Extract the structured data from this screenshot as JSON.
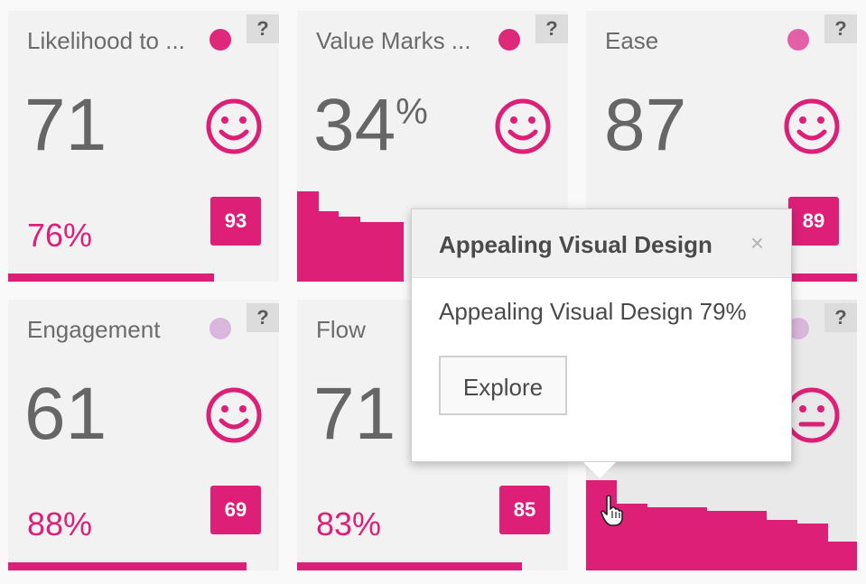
{
  "colors": {
    "accent": "#dd1f78",
    "dot_strong": "#e0287a",
    "dot_medium": "#e360a8",
    "dot_light": "#d9b7dc"
  },
  "cards": [
    {
      "title": "Likelihood to ...",
      "score": "71",
      "percent": "76%",
      "badge": "93",
      "dot": "#e0287a",
      "progress": 0.76,
      "face": "happy"
    },
    {
      "title": "Value Marks ...",
      "score": "34",
      "score_suffix": "%",
      "dot": "#e0287a",
      "face": "happy"
    },
    {
      "title": "Ease",
      "score": "87",
      "badge": "89",
      "dot": "#e360a8",
      "face": "happy"
    },
    {
      "title": "Engagement",
      "score": "61",
      "percent": "88%",
      "badge": "69",
      "dot": "#d9b7dc",
      "progress": 0.88,
      "face": "happy"
    },
    {
      "title": "Flow",
      "score": "71",
      "percent": "83%",
      "badge": "85",
      "dot": "#e0287a",
      "progress": 0.83,
      "face": "happy"
    },
    {
      "dot": "#d9b7dc",
      "face": "neutral"
    }
  ],
  "help_label": "?",
  "popover": {
    "title": "Appealing Visual Design",
    "close": "×",
    "body": "Appealing Visual Design 79%",
    "button": "Explore"
  }
}
